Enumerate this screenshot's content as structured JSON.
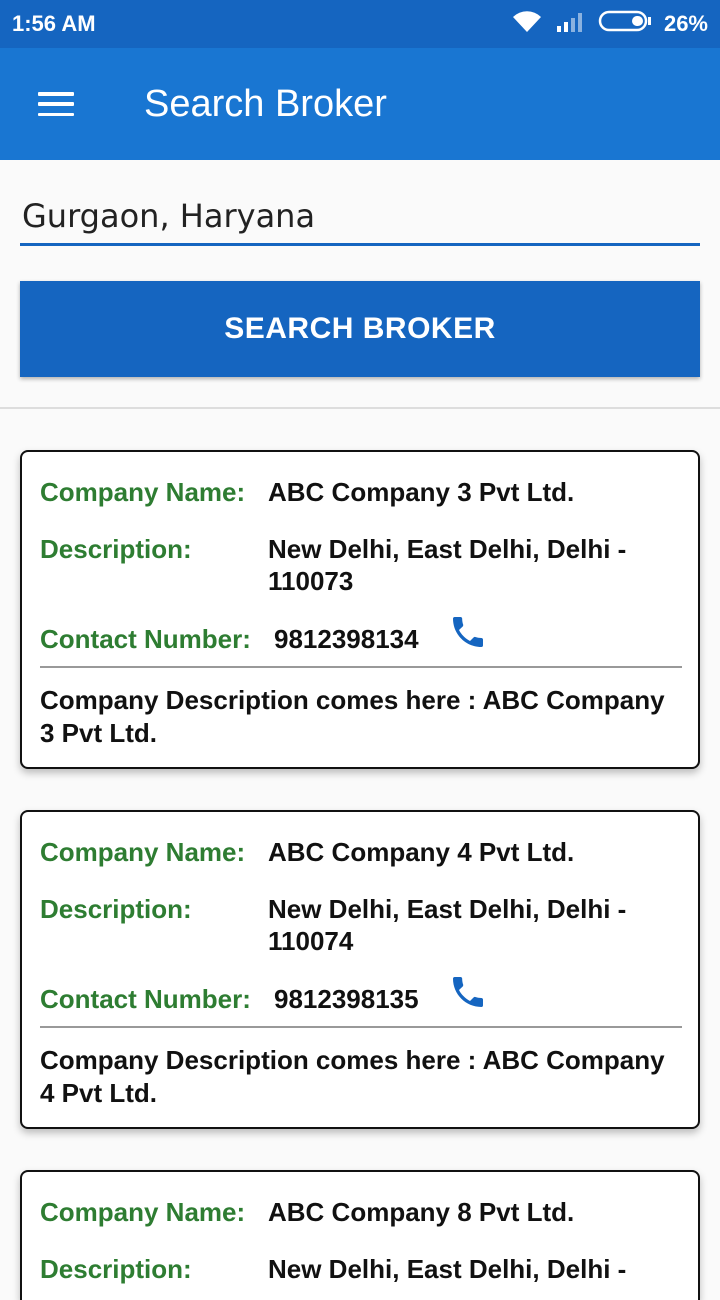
{
  "status_bar": {
    "time": "1:56 AM",
    "battery": "26%"
  },
  "app_bar": {
    "title": "Search Broker"
  },
  "search": {
    "value": "Gurgaon, Haryana",
    "button_label": "SEARCH BROKER"
  },
  "labels": {
    "company_name": "Company Name:",
    "description": "Description:",
    "contact_number": "Contact Number:"
  },
  "results": [
    {
      "company_name": "ABC Company 3 Pvt Ltd.",
      "description": "New Delhi, East Delhi, Delhi - 110073",
      "contact_number": "9812398134",
      "company_description": "Company Description comes here : ABC Company 3 Pvt Ltd."
    },
    {
      "company_name": "ABC Company 4 Pvt Ltd.",
      "description": "New Delhi, East Delhi, Delhi - 110074",
      "contact_number": "9812398135",
      "company_description": "Company Description comes here : ABC Company 4 Pvt Ltd."
    },
    {
      "company_name": "ABC Company 8 Pvt Ltd.",
      "description": "New Delhi, East Delhi, Delhi -"
    }
  ],
  "colors": {
    "status_bar": "#1565c0",
    "app_bar": "#1976d2",
    "button": "#1565c0",
    "label_green": "#2e7d32",
    "phone_icon": "#1565c0"
  },
  "icons": {
    "menu": "hamburger-menu-icon",
    "wifi": "wifi-icon",
    "signal": "signal-icon",
    "battery": "battery-icon",
    "phone": "phone-icon"
  }
}
